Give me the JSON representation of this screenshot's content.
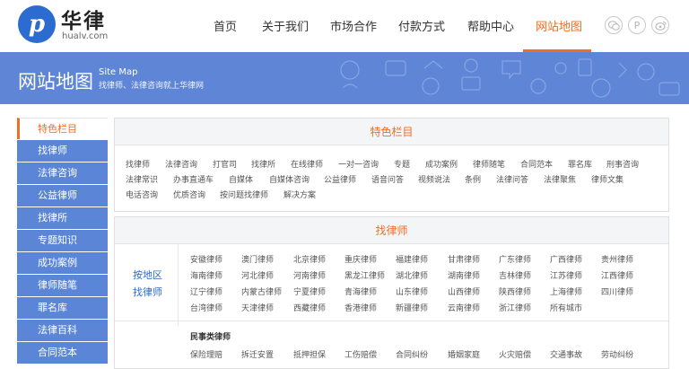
{
  "logo": {
    "mark": "p",
    "cn": "华律",
    "en": "hualv.com"
  },
  "nav": {
    "items": [
      {
        "label": "首页"
      },
      {
        "label": "关于我们"
      },
      {
        "label": "市场合作"
      },
      {
        "label": "付款方式"
      },
      {
        "label": "帮助中心"
      },
      {
        "label": "网站地图",
        "active": true
      }
    ]
  },
  "social": [
    "wechat-icon",
    "pinterest-icon",
    "weibo-icon"
  ],
  "banner": {
    "title": "网站地图",
    "en": "Site Map",
    "sub": "找律师、法律咨询就上华律网"
  },
  "sidebar": {
    "items": [
      "特色栏目",
      "找律师",
      "法律咨询",
      "公益律师",
      "找律所",
      "专题知识",
      "成功案例",
      "律师随笔",
      "罪名库",
      "法律百科",
      "合同范本"
    ]
  },
  "featured": {
    "title": "特色栏目",
    "rows": [
      [
        "找律师",
        "法律咨询",
        "打官司",
        "找律所",
        "在线律师",
        "一对一咨询",
        "专题",
        "成功案例",
        "律师随笔",
        "合同范本",
        "罪名库",
        "刑事咨询"
      ],
      [
        "法律常识",
        "办事直通车",
        "自媒体",
        "自媒体咨询",
        "公益律师",
        "语音问答",
        "视频说法",
        "条例",
        "法律问答",
        "法律聚焦",
        "律师文集"
      ],
      [
        "电话咨询",
        "优质咨询",
        "按问题找律师",
        "解决方案"
      ]
    ]
  },
  "lawyers": {
    "title": "找律师",
    "region_label": [
      "按地区",
      "找律师"
    ],
    "rows": [
      [
        "安徽律师",
        "澳门律师",
        "北京律师",
        "重庆律师",
        "福建律师",
        "甘肃律师",
        "广东律师",
        "广西律师",
        "贵州律师"
      ],
      [
        "海南律师",
        "河北律师",
        "河南律师",
        "黑龙江律师",
        "湖北律师",
        "湖南律师",
        "吉林律师",
        "江苏律师",
        "江西律师"
      ],
      [
        "辽宁律师",
        "内蒙古律师",
        "宁夏律师",
        "青海律师",
        "山东律师",
        "山西律师",
        "陕西律师",
        "上海律师",
        "四川律师"
      ],
      [
        "台湾律师",
        "天津律师",
        "西藏律师",
        "香港律师",
        "新疆律师",
        "云南律师",
        "浙江律师",
        "所有城市"
      ]
    ],
    "subcat_title": "民事类律师",
    "subcat_row": [
      "保险理赔",
      "拆迁安置",
      "抵押担保",
      "工伤赔偿",
      "合同纠纷",
      "婚姻家庭",
      "火灾赔偿",
      "交通事故",
      "劳动纠纷"
    ]
  }
}
